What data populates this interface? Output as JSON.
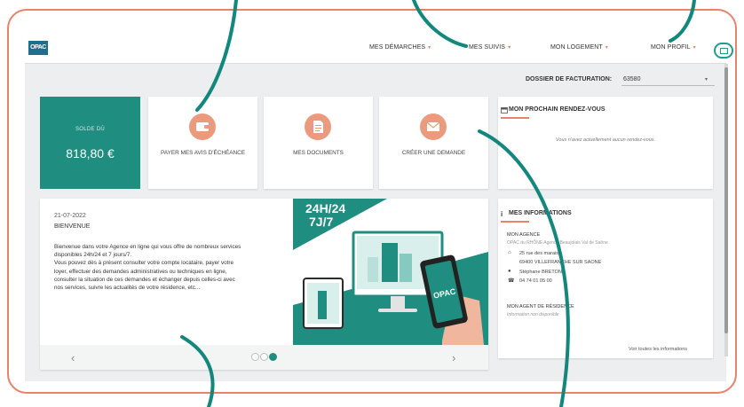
{
  "colors": {
    "frame": "#e8826b",
    "teal": "#1f8d7f",
    "callout": "#12877d",
    "accent": "#e8826b",
    "tile_icon": "#eb9a7e"
  },
  "header": {
    "logo_text": "OPAC",
    "nav": [
      {
        "label": "MES DÉMARCHES"
      },
      {
        "label": "MES SUIVIS"
      },
      {
        "label": "MON LOGEMENT"
      },
      {
        "label": "MON PROFIL"
      }
    ],
    "mail_icon": "envelope-icon"
  },
  "dossier": {
    "label": "DOSSIER DE FACTURATION:",
    "value": "63580"
  },
  "tiles": {
    "solde_label": "SOLDE DÛ",
    "solde_value": "818,80 €",
    "pay_label": "PAYER MES AVIS D'ÉCHÉANCE",
    "docs_label": "MES DOCUMENTS",
    "request_label": "CRÉER UNE DEMANDE",
    "pay_icon": "wallet-icon",
    "docs_icon": "document-icon",
    "request_icon": "envelope-icon"
  },
  "rdv": {
    "title": "MON PROCHAIN RENDEZ-VOUS",
    "empty_text": "Vous n'avez actuellement aucun rendez-vous.",
    "icon": "calendar-icon"
  },
  "news": {
    "date": "21-07-2022",
    "title": "BIENVENUE",
    "body_lines": [
      "Bienvenue dans votre Agence en ligne qui vous offre de nombreux services",
      "disponibles 24h/24 et 7 jours/7.",
      "Vous pouvez dès à présent consulter votre compte locataire, payer votre",
      "loyer, effectuer des demandes administratives ou techniques en ligne,",
      "consulter la situation de ces demandes et échanger depuis celles-ci avec",
      "nos services, suivre les actualités de votre résidence, etc..."
    ],
    "banner_line1": "24H/24",
    "banner_line2": "7J/7",
    "phone_logo": "OPAC",
    "carousel_active": 3,
    "carousel_count": 3
  },
  "info": {
    "title": "MES INFORMATIONS",
    "agency_label": "MON AGENCE",
    "agency_name": "OPAC du RHÔNE Agence Beaujolais Val de Saône",
    "address_line1": "25 rue des marais",
    "address_line2": "69400 VILLEFRANCHE SUR SAONE",
    "contact_name": "Stéphane BRETON",
    "phone": "04 74 01 05 00",
    "residence_label": "MON AGENT DE RÉSIDENCE",
    "residence_value": "Information non disponible",
    "all_link": "Voir toutes les informations"
  }
}
